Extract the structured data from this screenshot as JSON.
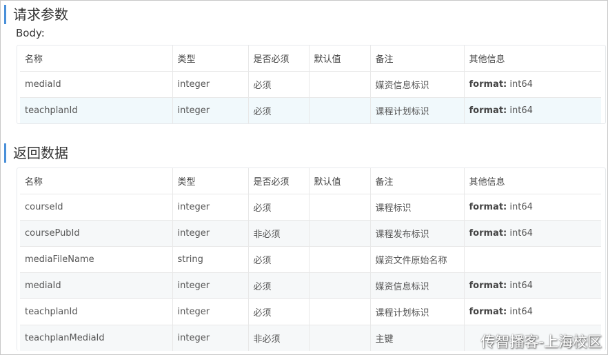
{
  "request": {
    "title": "请求参数",
    "body_label": "Body:",
    "headers": [
      "名称",
      "类型",
      "是否必须",
      "默认值",
      "备注",
      "其他信息"
    ],
    "rows": [
      {
        "name": "mediaId",
        "type": "integer",
        "required": "必须",
        "default": "",
        "remark": "媒资信息标识",
        "other_key": "format:",
        "other_val": " int64"
      },
      {
        "name": "teachplanId",
        "type": "integer",
        "required": "必须",
        "default": "",
        "remark": "课程计划标识",
        "other_key": "format:",
        "other_val": " int64"
      }
    ]
  },
  "response": {
    "title": "返回数据",
    "headers": [
      "名称",
      "类型",
      "是否必须",
      "默认值",
      "备注",
      "其他信息"
    ],
    "rows": [
      {
        "name": "courseId",
        "type": "integer",
        "required": "必须",
        "default": "",
        "remark": "课程标识",
        "other_key": "format:",
        "other_val": " int64"
      },
      {
        "name": "coursePubId",
        "type": "integer",
        "required": "非必须",
        "default": "",
        "remark": "课程发布标识",
        "other_key": "format:",
        "other_val": " int64"
      },
      {
        "name": "mediaFileName",
        "type": "string",
        "required": "必须",
        "default": "",
        "remark": "媒资文件原始名称",
        "other_key": "",
        "other_val": ""
      },
      {
        "name": "mediaId",
        "type": "integer",
        "required": "必须",
        "default": "",
        "remark": "媒资信息标识",
        "other_key": "format:",
        "other_val": " int64"
      },
      {
        "name": "teachplanId",
        "type": "integer",
        "required": "必须",
        "default": "",
        "remark": "课程计划标识",
        "other_key": "format:",
        "other_val": " int64"
      },
      {
        "name": "teachplanMediaId",
        "type": "integer",
        "required": "非必须",
        "default": "",
        "remark": "主键",
        "other_key": "",
        "other_val": ""
      }
    ]
  },
  "watermark": "传智播客-上海校区"
}
